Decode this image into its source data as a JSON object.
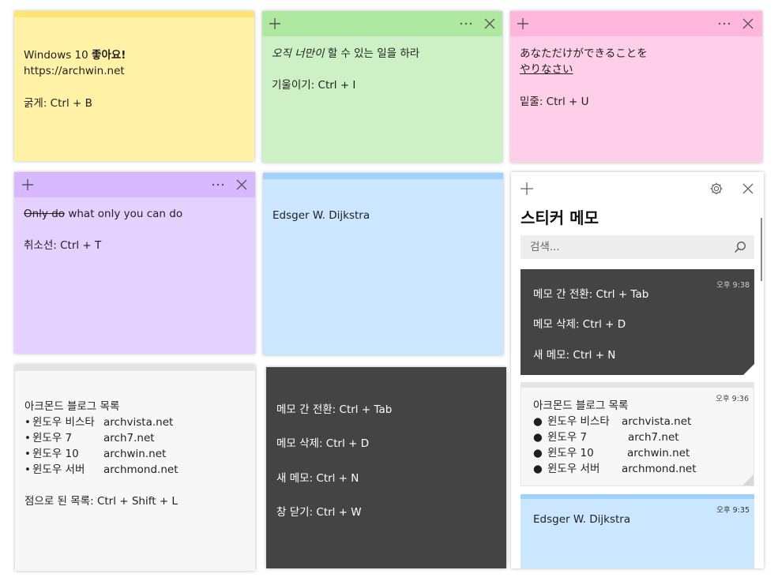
{
  "colors": {
    "yellow_bg": "#fff1a6",
    "yellow_strip": "#ffe574",
    "green_bg": "#cdf1c5",
    "green_bar": "#aee8a1",
    "pink_bg": "#ffcfe9",
    "pink_bar": "#ffb6dc",
    "purple_bg": "#e5d1ff",
    "purple_bar": "#d8b8ff",
    "blue_bg": "#cbe7ff",
    "blue_strip": "#9fd2ff",
    "gray_bg": "#f7f7f7",
    "gray_strip": "#e4e4e4",
    "charcoal_bg": "#444444"
  },
  "icons": {
    "add": "+",
    "more": "···",
    "close": "✕",
    "search": "⌕",
    "settings": "⚙"
  },
  "notes": {
    "yellow": {
      "line1_prefix": "Windows 10 ",
      "line1_bold": "좋아요!",
      "line2": "https://archwin.net",
      "line3": "굵게: Ctrl + B"
    },
    "green": {
      "line1_italic": "오직 너만이",
      "line1_rest": " 할 수 있는 일을 하라",
      "line2": "기울이기: Ctrl + I"
    },
    "pink": {
      "line1": "あなただけができることを",
      "line2_underline": "やりなさい",
      "line3": "밑줄: Ctrl + U"
    },
    "purple": {
      "line1_strike": "Only do",
      "line1_rest": " what only you can do",
      "line2": "취소선: Ctrl + T"
    },
    "blue": {
      "line1": "Edsger W. Dijkstra"
    },
    "gray": {
      "title": "아크몬드 블로그 목록",
      "bullet": "•",
      "items": [
        {
          "name": "윈도우 비스타",
          "site": "archvista.net"
        },
        {
          "name": "윈도우 7",
          "site": "arch7.net"
        },
        {
          "name": "윈도우 10",
          "site": "archwin.net"
        },
        {
          "name": "윈도우 서버",
          "site": "archmond.net"
        }
      ],
      "footer": "점으로 된 목록: Ctrl + Shift + L"
    },
    "charcoal": {
      "lines": [
        "메모 간 전환: Ctrl + Tab",
        "메모 삭제: Ctrl + D",
        "새 메모: Ctrl + N",
        "창 닫기: Ctrl + W"
      ]
    }
  },
  "hub": {
    "title": "스티커 메모",
    "search_placeholder": "검색...",
    "cards": [
      {
        "time": "오후 9:38",
        "lines": [
          "메모 간 전환: Ctrl + Tab",
          "메모 삭제: Ctrl + D",
          "새 메모: Ctrl + N"
        ]
      },
      {
        "time": "오후 9:36",
        "title": "아크몬드 블로그 목록",
        "bullet": "●",
        "items": [
          {
            "name": "윈도우 비스타",
            "site": "archvista.net"
          },
          {
            "name": "윈도우 7",
            "site": "arch7.net"
          },
          {
            "name": "윈도우 10",
            "site": "archwin.net"
          },
          {
            "name": "윈도우 서버",
            "site": "archmond.net"
          }
        ]
      },
      {
        "time": "오후 9:35",
        "line1": "Edsger W. Dijkstra"
      }
    ]
  }
}
